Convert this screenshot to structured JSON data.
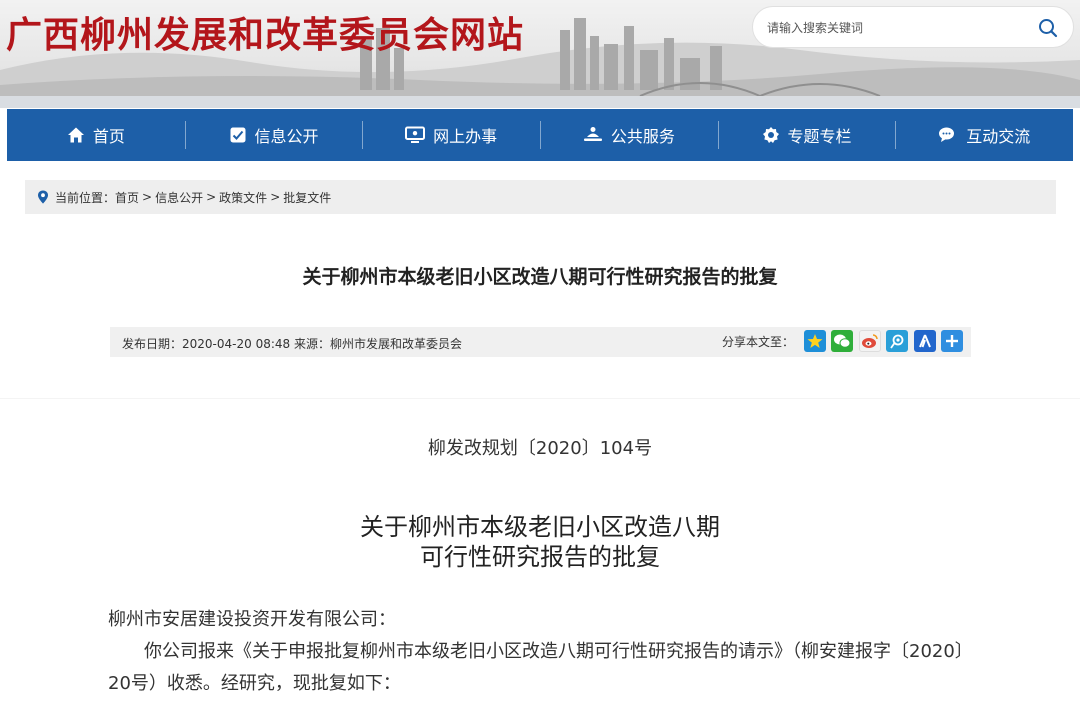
{
  "header": {
    "site_title": "广西柳州发展和改革委员会网站",
    "search": {
      "placeholder": "请输入搜索关键词",
      "icon": "search-icon"
    }
  },
  "nav": {
    "items": [
      {
        "label": "首页",
        "icon": "home-icon"
      },
      {
        "label": "信息公开",
        "icon": "info-icon"
      },
      {
        "label": "网上办事",
        "icon": "monitor-icon"
      },
      {
        "label": "公共服务",
        "icon": "service-icon"
      },
      {
        "label": "专题专栏",
        "icon": "badge-icon"
      },
      {
        "label": "互动交流",
        "icon": "chat-icon"
      }
    ],
    "color": "#1d5fa8"
  },
  "breadcrumb": {
    "prefix": "当前位置：",
    "items": [
      "首页",
      "信息公开",
      "政策文件",
      "批复文件"
    ],
    "separator": ">"
  },
  "article": {
    "title": "关于柳州市本级老旧小区改造八期可行性研究报告的批复",
    "meta": {
      "date_label": "发布日期：",
      "date": "2020-04-20 08:48",
      "source_label": "来源：",
      "source": "柳州市发展和改革委员会"
    },
    "share": {
      "label": "分享本文至：",
      "icons": [
        {
          "name": "qzone-icon",
          "color": "#1e8fd8"
        },
        {
          "name": "wechat-icon",
          "color": "#2fae3a"
        },
        {
          "name": "weibo-icon",
          "color": "#e04b3b"
        },
        {
          "name": "tencent-weibo-icon",
          "color": "#2a9fd8"
        },
        {
          "name": "renren-icon",
          "color": "#2266cc"
        },
        {
          "name": "more-share-icon",
          "color": "#2f8ee0"
        }
      ]
    }
  },
  "document": {
    "number": "柳发改规划〔2020〕104号",
    "title_line1": "关于柳州市本级老旧小区改造八期",
    "title_line2": "可行性研究报告的批复",
    "salutation": "柳州市安居建设投资开发有限公司：",
    "body": "你公司报来《关于申报批复柳州市本级老旧小区改造八期可行性研究报告的请示》（柳安建报字〔2020〕20号）收悉。经研究，现批复如下："
  },
  "colors": {
    "title_red": "#b3161b",
    "nav_blue": "#1d5fa8"
  }
}
